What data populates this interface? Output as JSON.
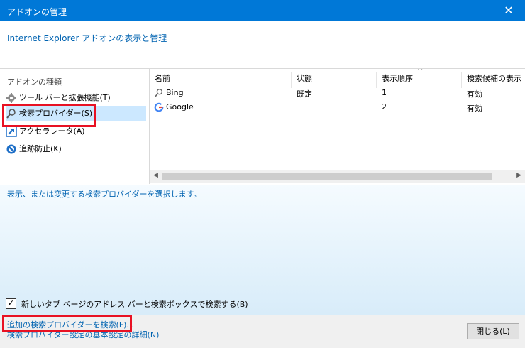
{
  "window": {
    "title": "アドオンの管理",
    "close_glyph": "✕"
  },
  "header": {
    "title": "Internet Explorer アドオンの表示と管理"
  },
  "sidebar": {
    "title": "アドオンの種類",
    "items": [
      {
        "label": "ツール バーと拡張機能(T)",
        "icon": "gear-icon"
      },
      {
        "label": "検索プロバイダー(S)",
        "icon": "search-icon",
        "selected": true
      },
      {
        "label": "アクセラレータ(A)",
        "icon": "accelerator-icon"
      },
      {
        "label": "追跡防止(K)",
        "icon": "block-icon"
      }
    ]
  },
  "grid": {
    "columns": [
      "名前",
      "状態",
      "表示順序",
      "検索候補の表示"
    ],
    "sort_glyph": "^",
    "rows": [
      {
        "name": "Bing",
        "status": "既定",
        "order": "1",
        "suggestions": "有効",
        "icon": "search-icon"
      },
      {
        "name": "Google",
        "status": "",
        "order": "2",
        "suggestions": "有効",
        "icon": "google-icon"
      }
    ]
  },
  "details": {
    "text": "表示、または変更する検索プロバイダーを選択します。",
    "checkbox_label": "新しいタブ ページのアドレス バーと検索ボックスで検索する(B)",
    "checkbox_checked": true,
    "checkbox_mark": "✓"
  },
  "footer": {
    "link1": "追加の検索プロバイダーを検索(F)...",
    "link2": "検索プロバイダー設定の基本設定の詳細(N)",
    "close_label": "閉じる(L)"
  },
  "colors": {
    "accent": "#0078d7",
    "highlight": "#e81123",
    "selection": "#cce8ff",
    "link": "#0063b1"
  }
}
